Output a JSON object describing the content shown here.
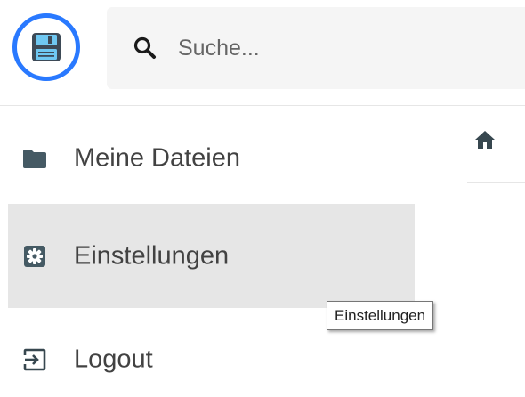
{
  "header": {
    "logo_icon": "floppy-disk-icon",
    "accent_color": "#2979ff",
    "search": {
      "icon": "search-icon",
      "placeholder": "Suche...",
      "value": ""
    }
  },
  "sidebar": {
    "items": [
      {
        "label": "Meine Dateien",
        "icon": "folder-icon",
        "active": false
      },
      {
        "label": "Einstellungen",
        "icon": "settings-icon",
        "active": true
      },
      {
        "label": "Logout",
        "icon": "logout-icon",
        "active": false
      }
    ]
  },
  "breadcrumb": {
    "home_icon": "home-icon"
  },
  "tooltip": {
    "text": "Einstellungen"
  }
}
